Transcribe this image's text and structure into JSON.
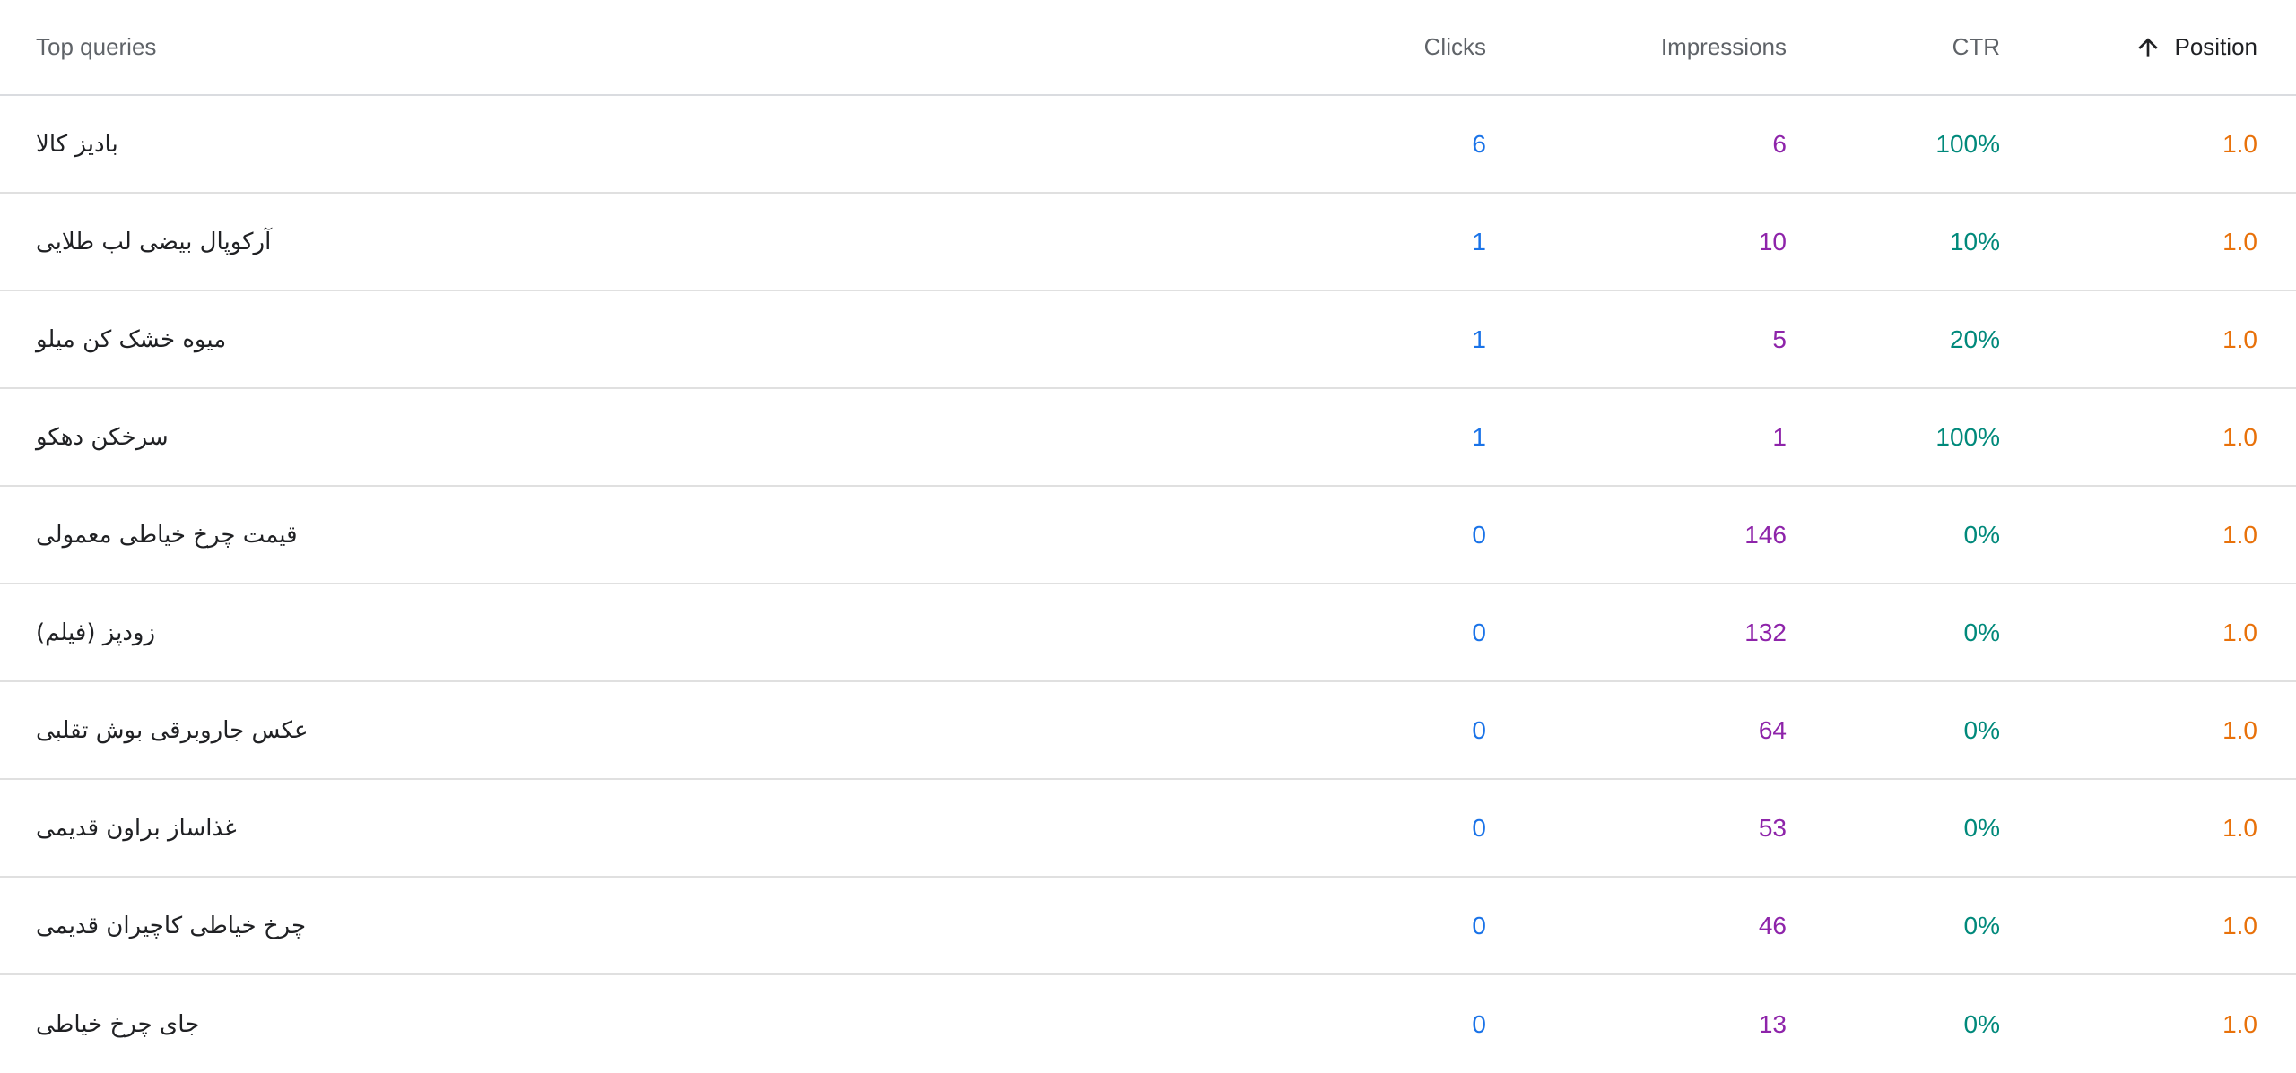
{
  "table": {
    "headers": {
      "query": "Top queries",
      "clicks": "Clicks",
      "impressions": "Impressions",
      "ctr": "CTR",
      "position": "Position",
      "sort_icon": "arrow-up-icon"
    },
    "rows": [
      {
        "query": "بادیز کالا",
        "clicks": "6",
        "impressions": "6",
        "ctr": "100%",
        "position": "1.0"
      },
      {
        "query": "آرکوپال بیضی لب طلایی",
        "clicks": "1",
        "impressions": "10",
        "ctr": "10%",
        "position": "1.0"
      },
      {
        "query": "میوه خشک کن میلو",
        "clicks": "1",
        "impressions": "5",
        "ctr": "20%",
        "position": "1.0"
      },
      {
        "query": "سرخکن دهکو",
        "clicks": "1",
        "impressions": "1",
        "ctr": "100%",
        "position": "1.0"
      },
      {
        "query": "قیمت چرخ خیاطی معمولی",
        "clicks": "0",
        "impressions": "146",
        "ctr": "0%",
        "position": "1.0"
      },
      {
        "query": "زودپز (فیلم)",
        "clicks": "0",
        "impressions": "132",
        "ctr": "0%",
        "position": "1.0"
      },
      {
        "query": "عکس جاروبرقی بوش تقلبی",
        "clicks": "0",
        "impressions": "64",
        "ctr": "0%",
        "position": "1.0"
      },
      {
        "query": "غذاساز براون قدیمی",
        "clicks": "0",
        "impressions": "53",
        "ctr": "0%",
        "position": "1.0"
      },
      {
        "query": "چرخ خیاطی کاچیران قدیمی",
        "clicks": "0",
        "impressions": "46",
        "ctr": "0%",
        "position": "1.0"
      },
      {
        "query": "جای چرخ خیاطی",
        "clicks": "0",
        "impressions": "13",
        "ctr": "0%",
        "position": "1.0"
      }
    ]
  },
  "colors": {
    "clicks": "#1a73e8",
    "impressions": "#8e24aa",
    "ctr": "#00897b",
    "position": "#e8710a"
  }
}
